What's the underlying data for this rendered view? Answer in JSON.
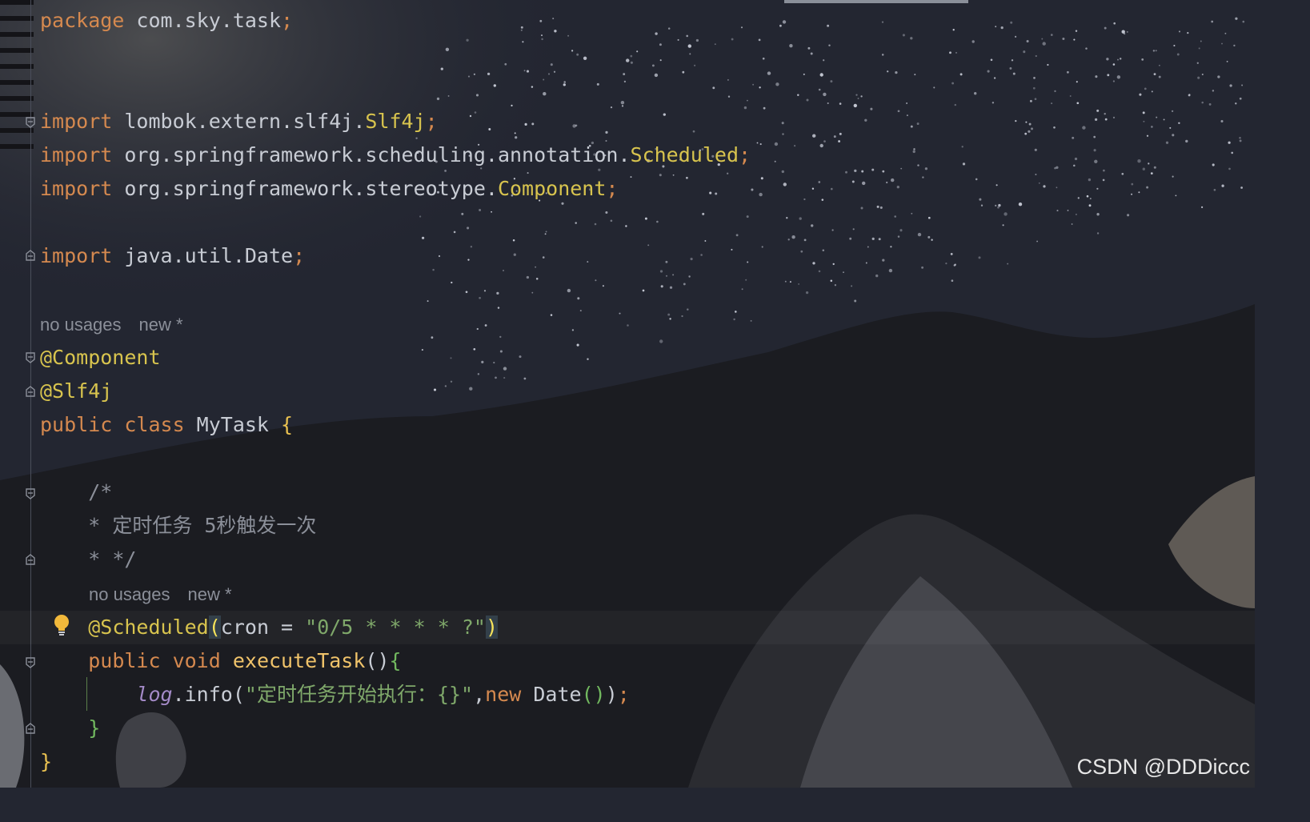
{
  "editor": {
    "lines": {
      "package_kw": "package",
      "package_name": " com.sky.task",
      "semi": ";",
      "import_kw": "import",
      "imp1_path": " lombok.extern.slf4j.",
      "imp1_cls": "Slf4j",
      "imp2_path": " org.springframework.scheduling.annotation.",
      "imp2_cls": "Scheduled",
      "imp3_path": " org.springframework.stereotype.",
      "imp3_cls": "Component",
      "imp4_path": " java.util.Date",
      "ann_component": "@Component",
      "ann_slf4j": "@Slf4j",
      "public_kw": "public",
      "class_kw": " class",
      "class_name": " MyTask ",
      "open_brace": "{",
      "comment_open": "/*",
      "comment_body": "* 定时任务 5秒触发一次",
      "comment_close": "* */",
      "ann_scheduled": "@Scheduled",
      "paren_open": "(",
      "cron_key": "cron = ",
      "cron_value": "\"0/5 * * * * ?\"",
      "paren_close": ")",
      "void_kw": " void",
      "method_name": " executeTask",
      "method_parens": "()",
      "log_var": "log",
      "log_call": ".info(",
      "log_msg": "\"定时任务开始执行：{}\"",
      "comma": ",",
      "new_kw": "new",
      "date_cls": " Date",
      "date_parens": "()",
      "close_call": ")",
      "close_brace": "}",
      "indent_4": "    ",
      "indent_8": "        "
    },
    "hints": {
      "usages": "no usages",
      "new_marker": "new *"
    }
  },
  "watermark": "CSDN @DDDiccc",
  "icons": [
    "fold-start-icon",
    "fold-end-icon",
    "lightbulb-icon"
  ],
  "colors": {
    "keyword": "#d5894f",
    "annotation": "#d8c44e",
    "string": "#7fa86a",
    "comment": "#8b8f99",
    "background": "#232631"
  }
}
